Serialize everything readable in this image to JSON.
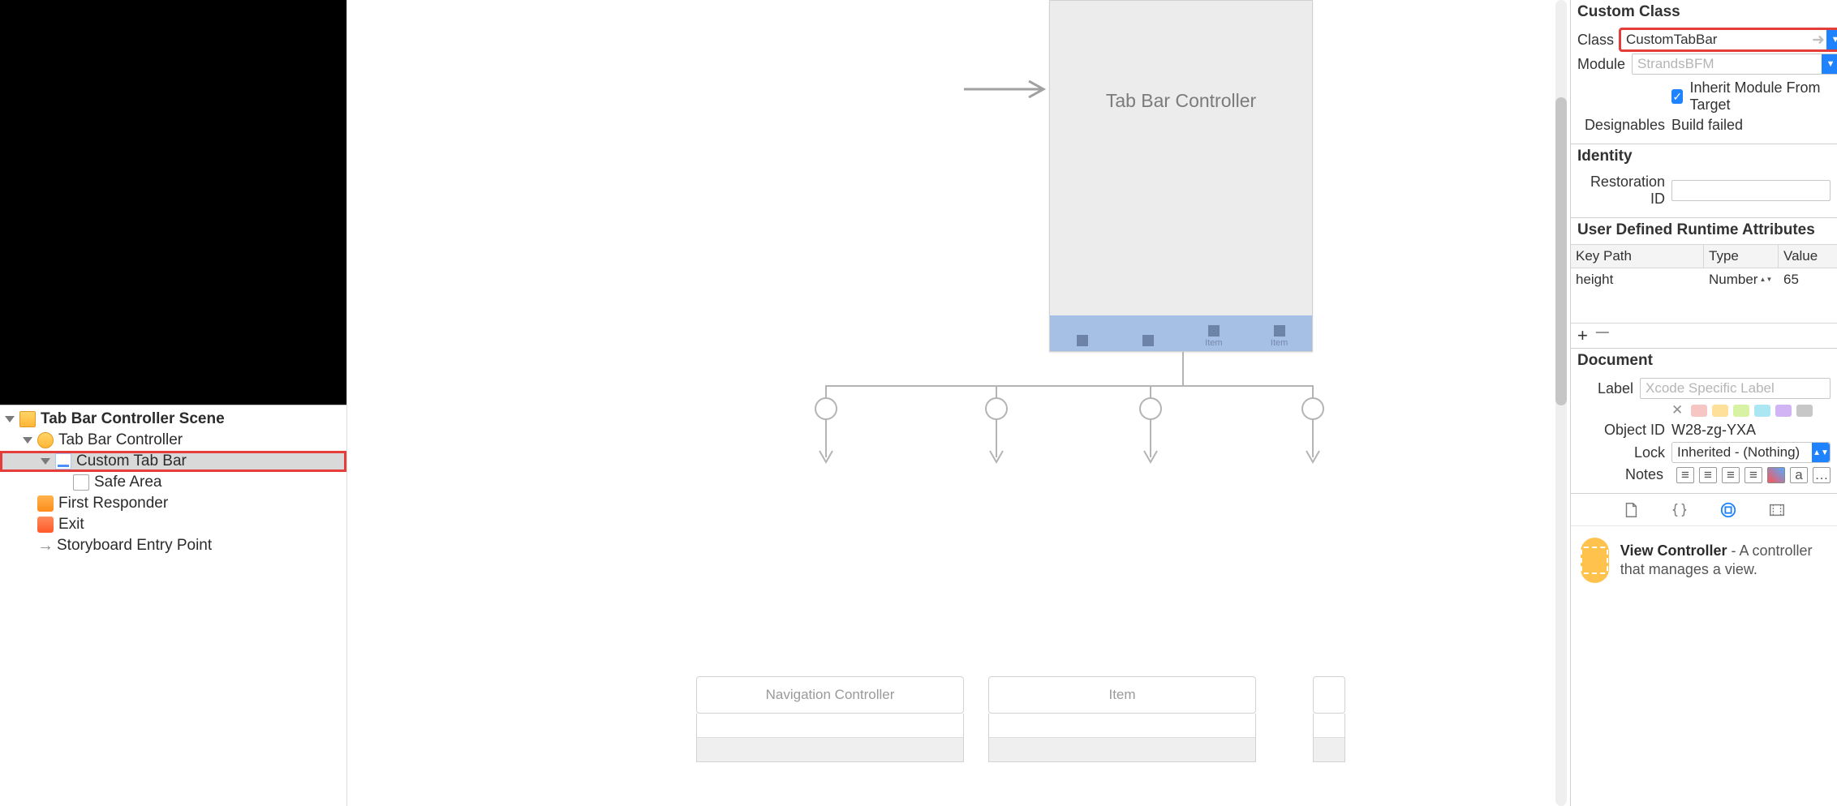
{
  "outline": {
    "scene": "Tab Bar Controller Scene",
    "items": [
      {
        "label": "Tab Bar Controller"
      },
      {
        "label": "Custom Tab Bar"
      },
      {
        "label": "Safe Area"
      },
      {
        "label": "First Responder"
      },
      {
        "label": "Exit"
      },
      {
        "label": "Storyboard Entry Point"
      }
    ]
  },
  "canvas": {
    "scene_title": "Tab Bar Controller",
    "tabs": [
      {
        "label": ""
      },
      {
        "label": ""
      },
      {
        "label": "Item"
      },
      {
        "label": "Item"
      }
    ],
    "destinations": [
      {
        "title": "Navigation Controller"
      },
      {
        "title": "Item"
      }
    ]
  },
  "inspector": {
    "custom_class": {
      "title": "Custom Class",
      "class_label": "Class",
      "class_value": "CustomTabBar",
      "module_label": "Module",
      "module_placeholder": "StrandsBFM",
      "inherit_label": "Inherit Module From Target",
      "designables_label": "Designables",
      "designables_value": "Build failed"
    },
    "identity": {
      "title": "Identity",
      "restoration_label": "Restoration ID"
    },
    "runtime": {
      "title": "User Defined Runtime Attributes",
      "headers": [
        "Key Path",
        "Type",
        "Value"
      ],
      "rows": [
        {
          "key": "height",
          "type": "Number",
          "value": "65"
        }
      ],
      "plus": "+",
      "minus": "—"
    },
    "document": {
      "title": "Document",
      "label_label": "Label",
      "label_placeholder": "Xcode Specific Label",
      "object_id_label": "Object ID",
      "object_id_value": "W28-zg-YXA",
      "lock_label": "Lock",
      "lock_value": "Inherited - (Nothing)",
      "notes_label": "Notes"
    },
    "library_item": {
      "title": "View Controller",
      "desc": " - A controller that manages a view."
    }
  }
}
